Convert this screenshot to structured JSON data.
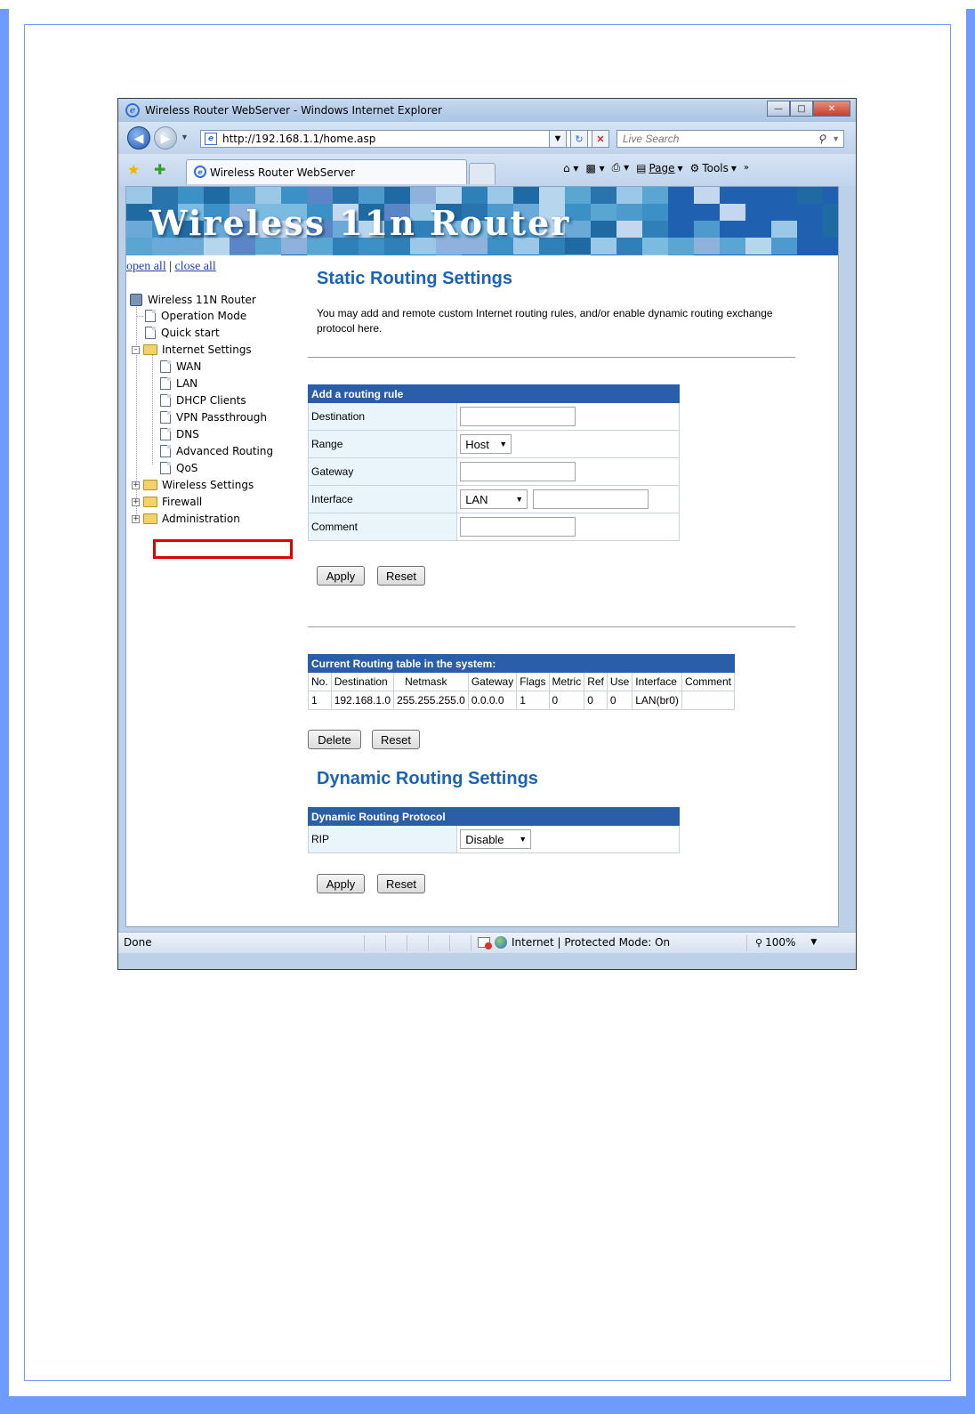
{
  "window": {
    "title": "Wireless Router WebServer - Windows Internet Explorer",
    "address": "http://192.168.1.1/home.asp",
    "search_placeholder": "Live Search",
    "tab_title": "Wireless Router WebServer",
    "cmd_page": "Page",
    "cmd_tools": "Tools"
  },
  "banner": {
    "title": "Wireless 11n Router"
  },
  "tree": {
    "open_all": "open all",
    "separator": "|",
    "close_all": "close all",
    "root": "Wireless 11N Router",
    "items": [
      "Operation Mode",
      "Quick start",
      "Internet Settings",
      "WAN",
      "LAN",
      "DHCP Clients",
      "VPN Passthrough",
      "DNS",
      "Advanced Routing",
      "QoS",
      "Wireless Settings",
      "Firewall",
      "Administration"
    ]
  },
  "static": {
    "title": "Static Routing Settings",
    "description": "You may add and remote custom Internet routing rules, and/or enable dynamic routing exchange protocol here.",
    "form_header": "Add a routing rule",
    "labels": [
      "Destination",
      "Range",
      "Gateway",
      "Interface",
      "Comment"
    ],
    "range_value": "Host",
    "interface_value": "LAN",
    "apply": "Apply",
    "reset": "Reset"
  },
  "routing_table": {
    "header": "Current Routing table in the system:",
    "columns": [
      "No.",
      "Destination",
      "Netmask",
      "Gateway",
      "Flags",
      "Metric",
      "Ref",
      "Use",
      "Interface",
      "Comment"
    ],
    "rows": [
      [
        "1",
        "192.168.1.0",
        "255.255.255.0",
        "0.0.0.0",
        "1",
        "0",
        "0",
        "0",
        "LAN(br0)",
        ""
      ]
    ],
    "delete": "Delete",
    "reset": "Reset"
  },
  "dynamic": {
    "title": "Dynamic Routing Settings",
    "form_header": "Dynamic Routing Protocol",
    "label": "RIP",
    "value": "Disable",
    "apply": "Apply",
    "reset": "Reset"
  },
  "status": {
    "done": "Done",
    "zone": "Internet | Protected Mode: On",
    "zoom": "100%"
  }
}
